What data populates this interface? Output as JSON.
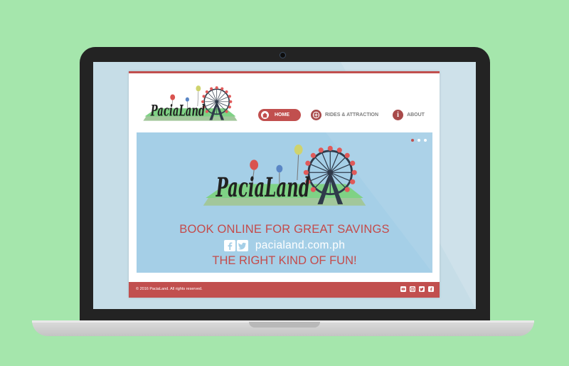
{
  "site": {
    "brand": "PaciaLand"
  },
  "nav": {
    "home": "HOME",
    "rides": "RIDES & ATTRACTION",
    "about": "ABOUT",
    "about_icon_glyph": "i"
  },
  "hero": {
    "line1": "BOOK ONLINE FOR GREAT SAVINGS",
    "url": "pacialand.com.ph",
    "line2": "THE RIGHT KIND OF FUN!",
    "slides_count": 3,
    "active_slide": 1
  },
  "footer": {
    "copyright": "© 2016 PaciaLand. All rights reserved.",
    "social_icons": [
      "youtube-icon",
      "instagram-icon",
      "twitter-icon",
      "facebook-icon"
    ]
  },
  "colors": {
    "background": "#a5e6ac",
    "accent": "#c14f4e",
    "hero_bg": "#a5cfe7",
    "laptop": "#232323",
    "screen_bg": "#c6dde7"
  }
}
